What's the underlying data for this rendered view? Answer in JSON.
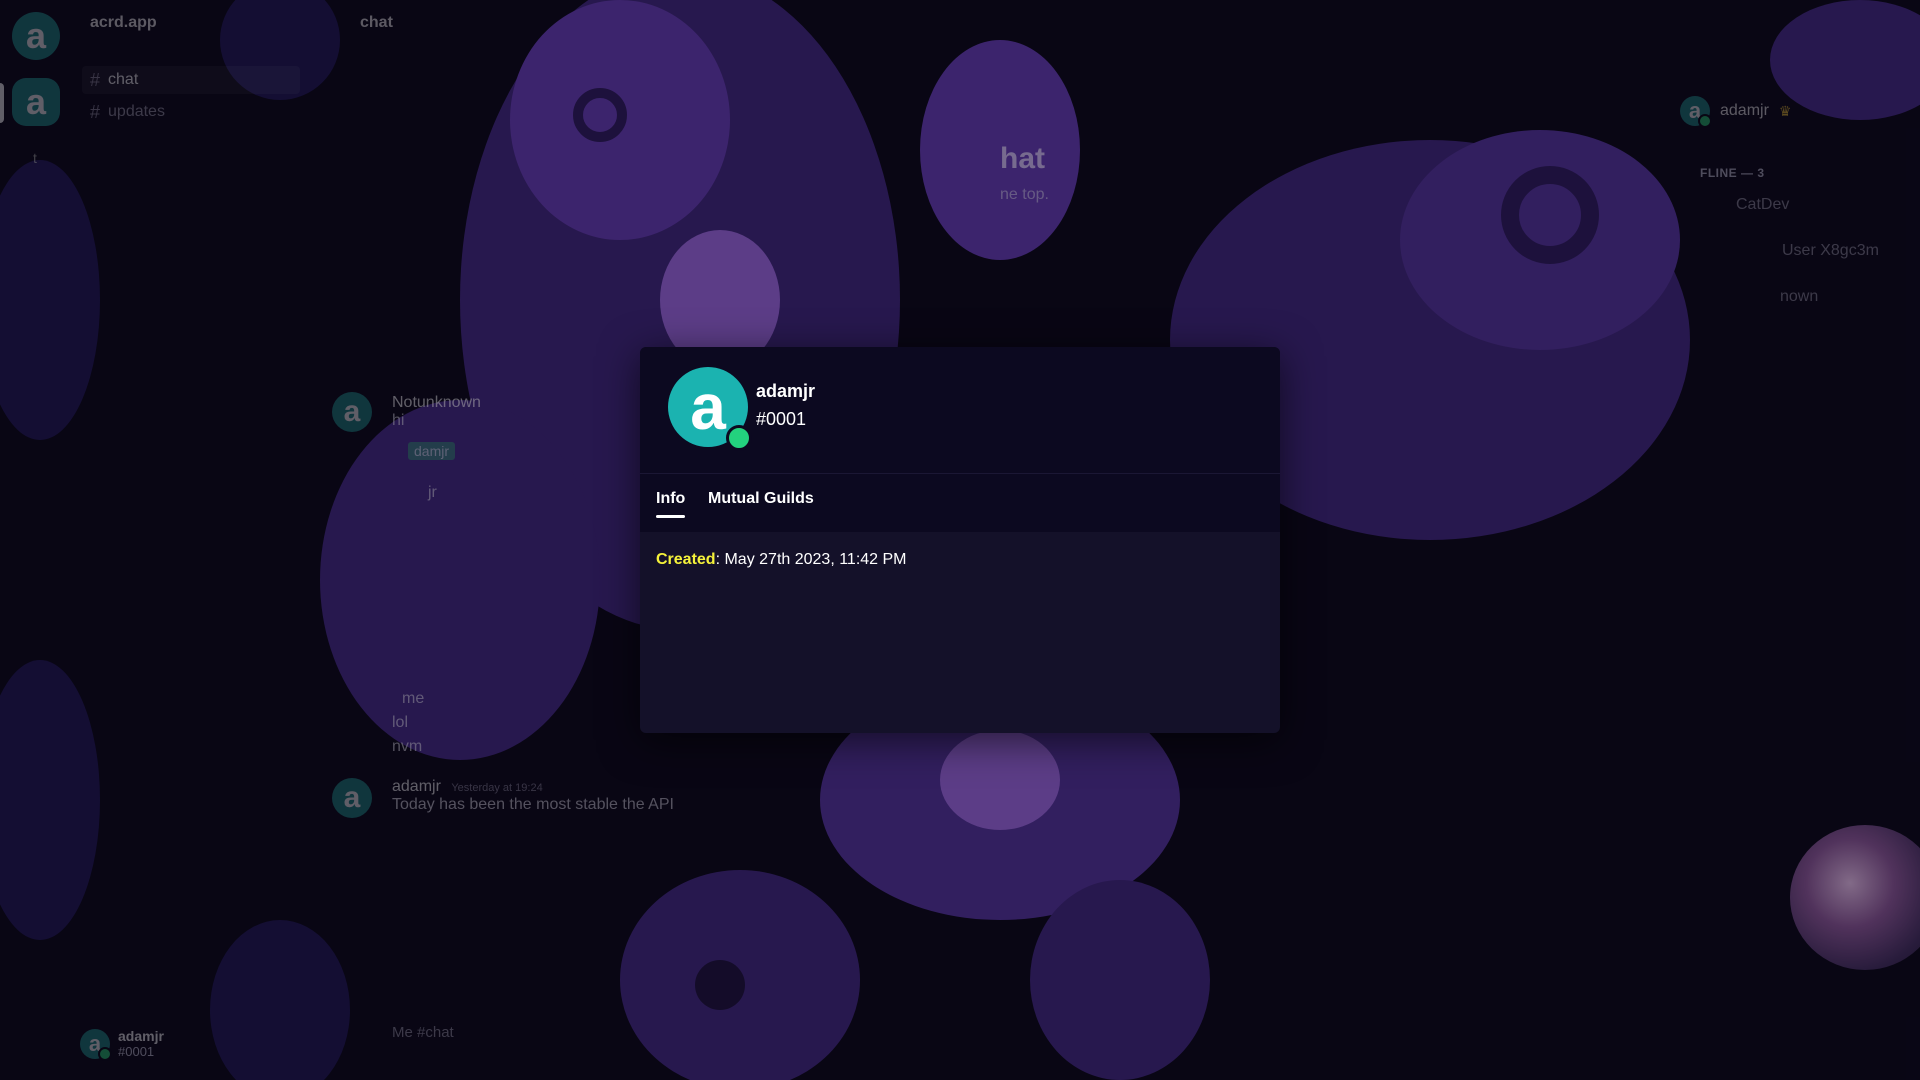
{
  "sidebar": {
    "guild_icon_letter": "a",
    "guild_name": "acrd.app",
    "channels": [
      {
        "label": "chat",
        "active": true
      },
      {
        "label": "updates",
        "active": false
      }
    ],
    "rail_divider": "t"
  },
  "self_panel": {
    "avatar_letter": "a",
    "username": "adamjr",
    "tag": "#0001"
  },
  "chat": {
    "title": "chat",
    "welcome_title": "hat",
    "welcome_sub": "ne top.",
    "messages": [
      {
        "author": "Notunknown",
        "text": "hi"
      },
      {
        "text": "jr"
      },
      {
        "text": "me"
      },
      {
        "text": "lol"
      },
      {
        "text": "nvm"
      },
      {
        "author": "adamjr",
        "time": "Yesterday at 19:24",
        "text": "Today has been the most stable the API"
      }
    ],
    "mention": "damjr",
    "input_placeholder": "Me    #chat"
  },
  "members": {
    "online": [
      {
        "name": "adamjr",
        "owner": true,
        "avatar_letter": "a"
      }
    ],
    "offline_header": "FLINE — 3",
    "offline": [
      {
        "name": "CatDev"
      },
      {
        "name": "User X8gc3m"
      },
      {
        "name": "nown"
      }
    ]
  },
  "profile_modal": {
    "avatar_letter": "a",
    "username": "adamjr",
    "discriminator": "#0001",
    "tabs": [
      {
        "label": "Info",
        "active": true
      },
      {
        "label": "Mutual Guilds",
        "active": false
      }
    ],
    "created_label": "Created",
    "created_value": ": May 27th 2023, 11:42 PM"
  },
  "colors": {
    "accent_teal": "#1bb3b0",
    "status_online": "#23d27e",
    "created_label": "#f5f23a",
    "modal_bg": "#141129",
    "modal_header_bg": "#0c0920",
    "crown": "#f0c437"
  },
  "icons": {
    "hash": "#",
    "crown": "♛"
  }
}
